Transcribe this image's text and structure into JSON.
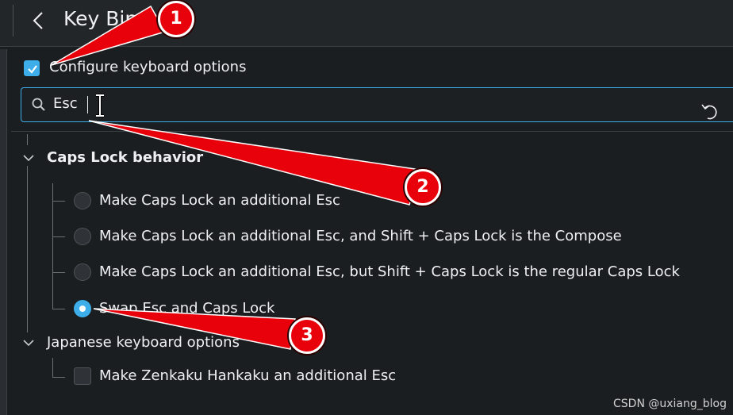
{
  "header": {
    "title": "Key Bindings",
    "back_icon": "chevron-left-icon"
  },
  "configure": {
    "label": "Configure keyboard options",
    "checked": true
  },
  "search": {
    "value": "Esc",
    "icon": "search-icon"
  },
  "groups": [
    {
      "label": "Caps Lock behavior",
      "expanded": true,
      "bold": true,
      "options": [
        {
          "label": "Make Caps Lock an additional Esc",
          "selected": false
        },
        {
          "label": "Make Caps Lock an additional Esc, and Shift + Caps Lock is the Compose",
          "selected": false
        },
        {
          "label": "Make Caps Lock an additional Esc, but Shift + Caps Lock is the regular Caps Lock",
          "selected": false
        },
        {
          "label": "Swap Esc and Caps Lock",
          "selected": true
        }
      ]
    },
    {
      "label": "Japanese keyboard options",
      "expanded": true,
      "bold": false,
      "options": [
        {
          "label": "Make Zenkaku Hankaku an additional Esc",
          "checked": false
        }
      ]
    }
  ],
  "annotations": [
    {
      "number": "1"
    },
    {
      "number": "2"
    },
    {
      "number": "3"
    }
  ],
  "watermark": "CSDN @uxiang_blog",
  "colors": {
    "accent": "#3daee9",
    "background": "#1b1e20",
    "annotation": "#e8000a"
  }
}
